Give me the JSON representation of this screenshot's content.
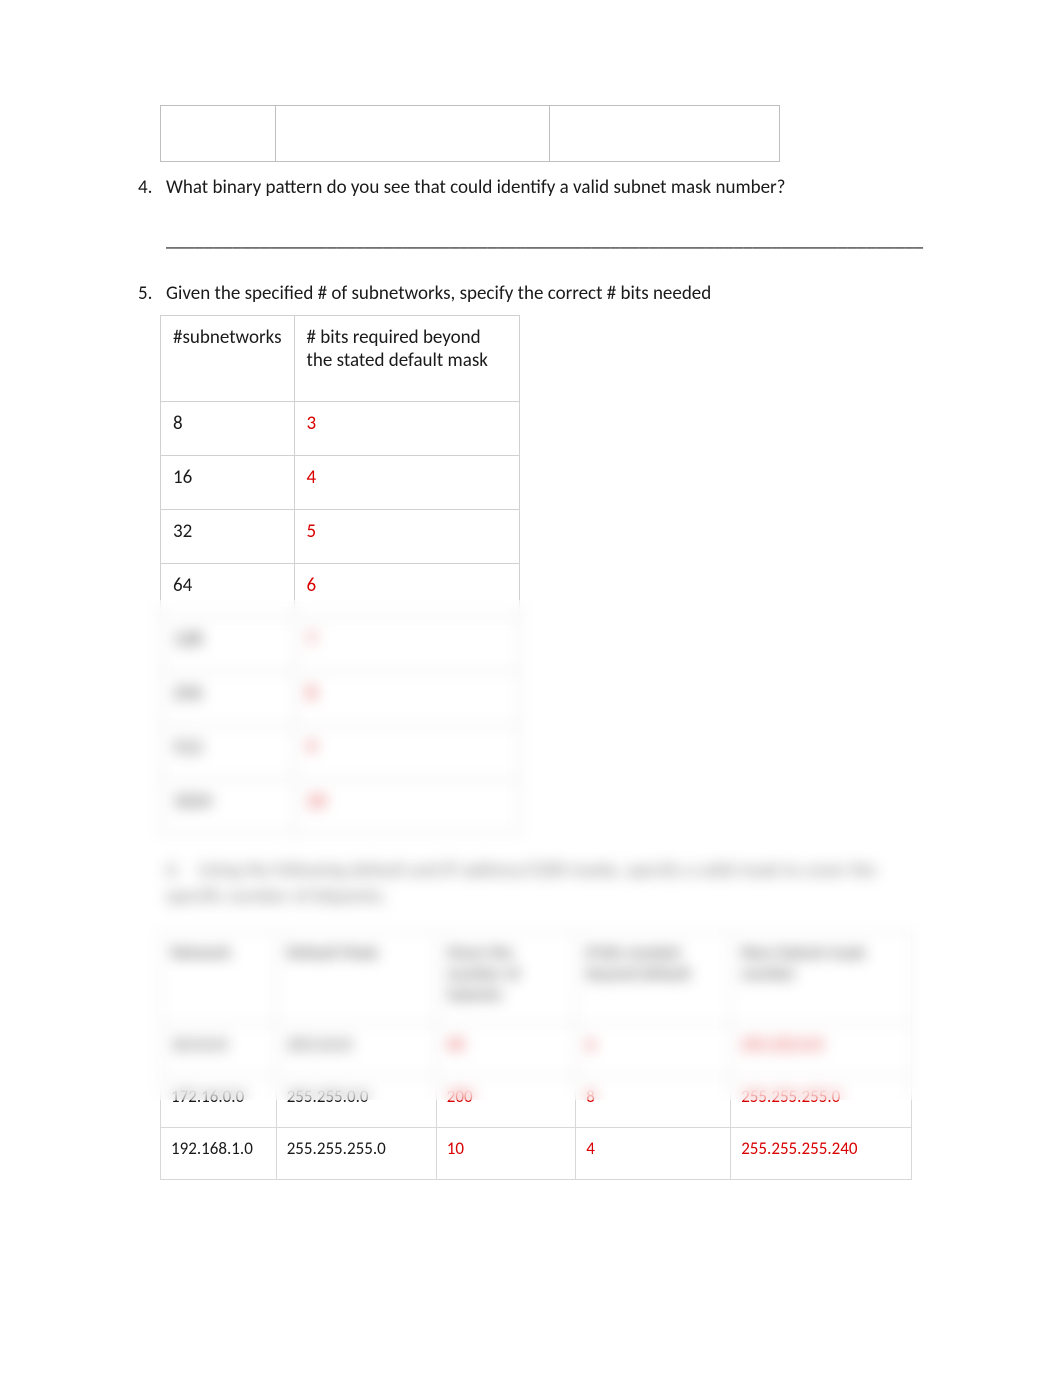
{
  "questions": {
    "q4": {
      "number": "4.",
      "text": "What binary pattern do you see that could identify a valid subnet mask number?",
      "blank": "________________________________________________________________________________"
    },
    "q5": {
      "number": "5.",
      "text": "Given the specified # of subnetworks, specify the correct # bits needed"
    },
    "q6": {
      "number": "6.",
      "text": "Using the following default and IP address/CIDR masks, specify a valid mask to cover the specific number of bitpoints."
    }
  },
  "subnet_table": {
    "headers": {
      "col1": "#subnetworks",
      "col2": "# bits required beyond the stated default mask"
    },
    "rows": [
      {
        "subnets": "8",
        "bits": "3"
      },
      {
        "subnets": "16",
        "bits": "4"
      },
      {
        "subnets": "32",
        "bits": "5"
      },
      {
        "subnets": "64",
        "bits": "6"
      },
      {
        "subnets": "128",
        "bits": "7"
      },
      {
        "subnets": "256",
        "bits": "8"
      },
      {
        "subnets": "512",
        "bits": "9"
      },
      {
        "subnets": "1024",
        "bits": "10"
      }
    ]
  },
  "big_table": {
    "headers": {
      "c1": "Network",
      "c2": "Default Mask",
      "c3": "Given the number of Subnets",
      "c4": "# bits needed beyond default",
      "c5": "New Subnet mask number"
    },
    "rows": [
      {
        "c1": "10.0.0.0",
        "c2": "255.0.0.0",
        "c3": "40",
        "c4": "6",
        "c5": "255.252.0.0"
      },
      {
        "c1": "172.16.0.0",
        "c2": "255.255.0.0",
        "c3": "200",
        "c4": "8",
        "c5": "255.255.255.0"
      },
      {
        "c1": "192.168.1.0",
        "c2": "255.255.255.0",
        "c3": "10",
        "c4": "4",
        "c5": "255.255.255.240"
      }
    ]
  }
}
